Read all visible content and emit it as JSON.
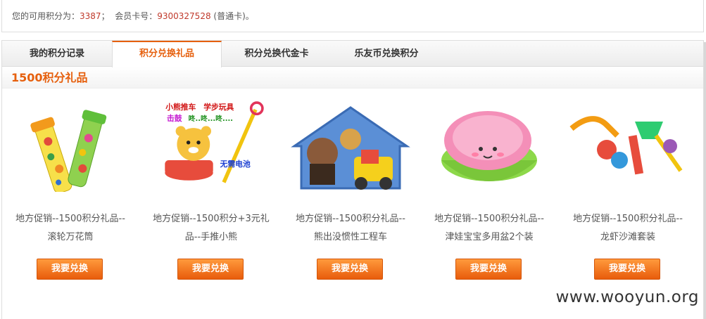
{
  "account": {
    "points_prefix": "您的可用积分为：",
    "points": "3387",
    "sep": "；",
    "card_prefix": "会员卡号：",
    "card_number": "9300327528",
    "card_type": "(普通卡)。"
  },
  "tabs": [
    {
      "label": "我的积分记录"
    },
    {
      "label": "积分兑换礼品"
    },
    {
      "label": "积分兑换代金卡"
    },
    {
      "label": "乐友币兑换积分"
    }
  ],
  "section": {
    "title": "1500积分礼品"
  },
  "products": [
    {
      "name": "地方促销--1500积分礼品--滚轮万花筒",
      "button": "我要兑换",
      "icon": "kaleidoscope-toy-image"
    },
    {
      "name": "地方促销--1500积分+3元礼品--手推小熊",
      "button": "我要兑换",
      "icon": "bear-push-toy-image",
      "image_text": {
        "line1a": "小熊推车",
        "line1b": "学步玩具",
        "line2a": "击鼓",
        "line2b": "咚..咚...咚....",
        "line3": "无需电池"
      }
    },
    {
      "name": "地方促销--1500积分礼品--熊出没惯性工程车",
      "button": "我要兑换",
      "icon": "engineering-truck-toy-image"
    },
    {
      "name": "地方促销--1500积分礼品--津娃宝宝多用盆2个装",
      "button": "我要兑换",
      "icon": "baby-basin-image"
    },
    {
      "name": "地方促销--1500积分礼品--龙虾沙滩套装",
      "button": "我要兑换",
      "icon": "beach-toy-set-image"
    }
  ],
  "watermark": "www.wooyun.org"
}
